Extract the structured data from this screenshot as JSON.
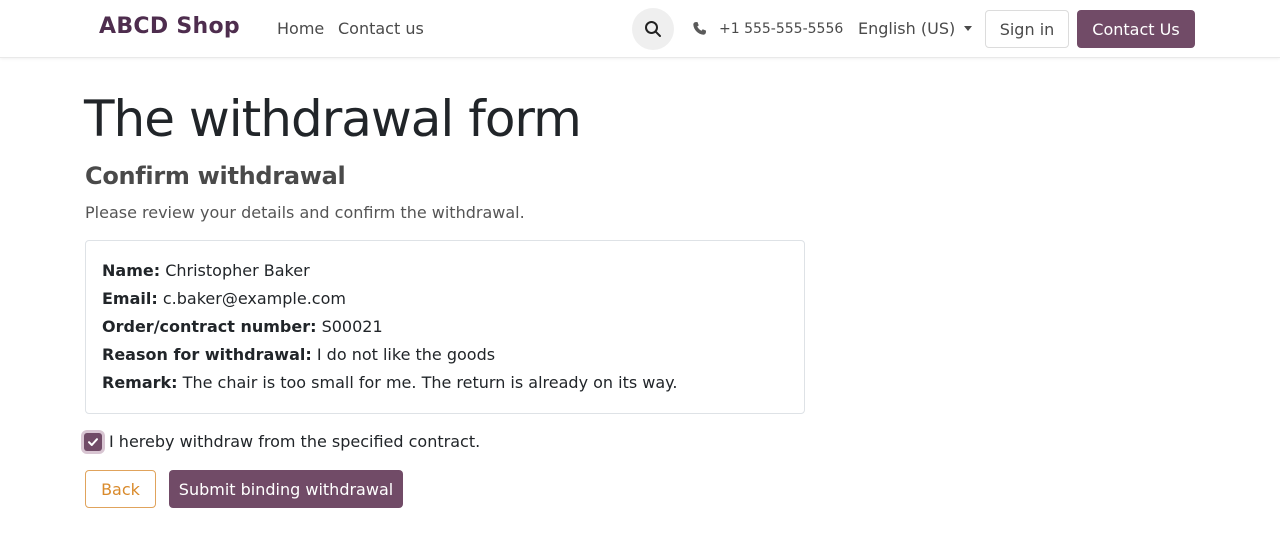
{
  "header": {
    "brand": "ABCD Shop",
    "nav": {
      "home": "Home",
      "contact": "Contact us"
    },
    "phone": "+1 555-555-5556",
    "language": "English (US)",
    "sign_in": "Sign in",
    "contact_button": "Contact Us",
    "icons": {
      "search": "search-icon",
      "phone": "phone-icon",
      "dropdown": "chevron-down-icon"
    }
  },
  "main": {
    "title": "The withdrawal form",
    "subtitle": "Confirm withdrawal",
    "intro": "Please review your details and confirm the withdrawal.",
    "details": {
      "name_label": "Name:",
      "name_value": "Christopher Baker",
      "email_label": "Email:",
      "email_value": "c.baker@example.com",
      "order_label": "Order/contract number:",
      "order_value": "S00021",
      "reason_label": "Reason for withdrawal:",
      "reason_value": "I do not like the goods",
      "remark_label": "Remark:",
      "remark_value": "The chair is too small for me. The return is already on its way."
    },
    "checkbox": {
      "label": "I hereby withdraw from the specified contract.",
      "checked": true
    },
    "buttons": {
      "back": "Back",
      "submit": "Submit binding withdrawal"
    }
  },
  "colors": {
    "primary": "#714b67",
    "brand_text": "#4e2d4e",
    "secondary_outline": "#e0a35c"
  }
}
